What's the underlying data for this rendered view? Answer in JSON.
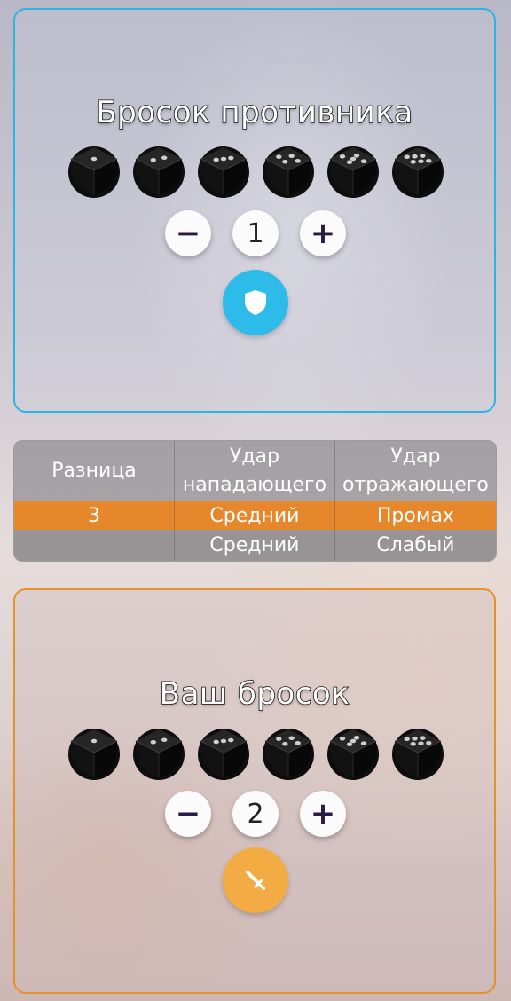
{
  "enemy": {
    "title": "Бросок противника",
    "dice": [
      1,
      2,
      3,
      4,
      5,
      6
    ],
    "count": "1",
    "minus_label": "−",
    "plus_label": "+",
    "action_icon": "shield-icon",
    "accent": "#2fb3e2"
  },
  "table": {
    "headers": [
      "Разница",
      "Удар нападающего",
      "Удар отражающего"
    ],
    "rows": [
      [
        "3",
        "Средний",
        "Промах"
      ],
      [
        "",
        "Средний",
        "Слабый"
      ]
    ],
    "highlight_color": "#e5872a"
  },
  "player": {
    "title": "Ваш бросок",
    "dice": [
      1,
      2,
      3,
      4,
      5,
      6
    ],
    "count": "2",
    "minus_label": "−",
    "plus_label": "+",
    "action_icon": "sword-icon",
    "accent": "#e5902b"
  }
}
